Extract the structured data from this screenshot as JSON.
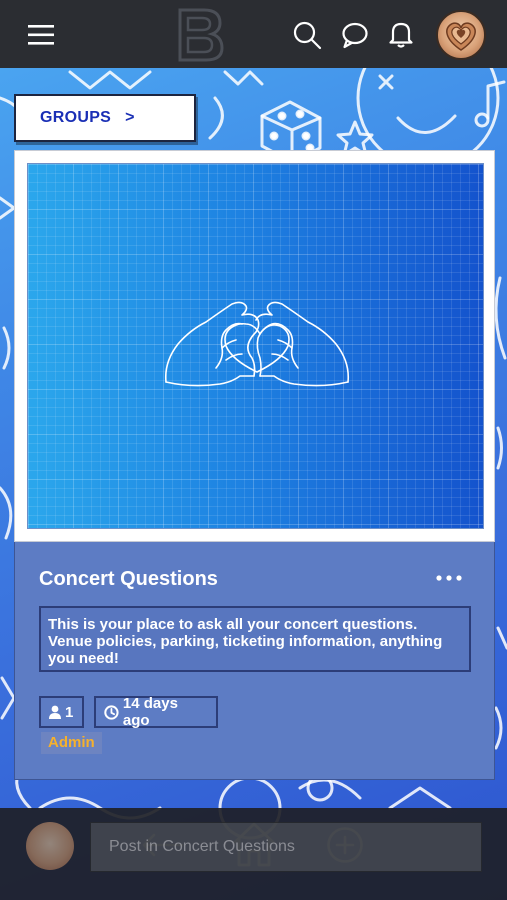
{
  "header": {
    "logo_letter": "B",
    "icons": [
      "menu-icon",
      "search-icon",
      "chat-icon",
      "bell-icon",
      "avatar"
    ]
  },
  "breadcrumb": {
    "label": "GROUPS",
    "chevron": ">"
  },
  "group": {
    "title": "Concert Questions",
    "description": "This is your place to ask all your concert questions. Venue policies, parking, ticketing information, anything you need!",
    "member_count": "1",
    "age": "14 days ago",
    "role": "Admin",
    "cover_icon": "heart-hands"
  },
  "composer": {
    "placeholder": "Post in Concert Questions"
  },
  "bottom_nav": {
    "icons": [
      "back-arrow-icon",
      "home-icon",
      "plus-circle-icon"
    ]
  },
  "colors": {
    "topbar": "#2b2d32",
    "background": "#3f87e6",
    "card_body": "#5d7cc4",
    "groups_text": "#1a2fb5",
    "role": "#f6b12c"
  }
}
